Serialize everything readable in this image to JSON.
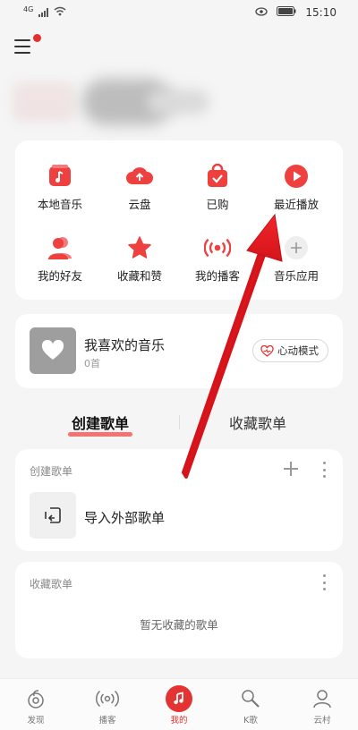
{
  "status_bar": {
    "network": "4G",
    "time": "15:10",
    "icons": [
      "signal-icon",
      "wifi-icon",
      "eye-icon",
      "battery-icon"
    ]
  },
  "header": {
    "menu_icon": "menu-icon",
    "has_notification_dot": true
  },
  "quick_access": [
    {
      "label": "本地音乐",
      "icon": "local-music-icon"
    },
    {
      "label": "云盘",
      "icon": "cloud-upload-icon"
    },
    {
      "label": "已购",
      "icon": "purchased-bag-icon"
    },
    {
      "label": "最近播放",
      "icon": "recent-play-icon"
    },
    {
      "label": "我的好友",
      "icon": "friends-icon"
    },
    {
      "label": "收藏和赞",
      "icon": "star-icon"
    },
    {
      "label": "我的播客",
      "icon": "podcast-broadcast-icon"
    },
    {
      "label": "音乐应用",
      "icon": "add-app-icon"
    }
  ],
  "favorites": {
    "title": "我喜欢的音乐",
    "count": "0首",
    "heart_mode_label": "心动模式"
  },
  "tabs": {
    "created": "创建歌单",
    "collected": "收藏歌单"
  },
  "created_playlists": {
    "header": "创建歌单",
    "import_label": "导入外部歌单"
  },
  "collected_playlists": {
    "header": "收藏歌单",
    "empty_text": "暂无收藏的歌单"
  },
  "bottom_nav": [
    {
      "label": "发现",
      "icon": "discover-icon",
      "active": false
    },
    {
      "label": "播客",
      "icon": "podcast-icon",
      "active": false
    },
    {
      "label": "我的",
      "icon": "music-note-icon",
      "active": true
    },
    {
      "label": "K歌",
      "icon": "karaoke-icon",
      "active": false
    },
    {
      "label": "云村",
      "icon": "community-icon",
      "active": false
    }
  ],
  "colors": {
    "accent": "#e33333",
    "background": "#f5f5f5",
    "card": "#ffffff",
    "annotation_arrow": "#e0181e"
  }
}
